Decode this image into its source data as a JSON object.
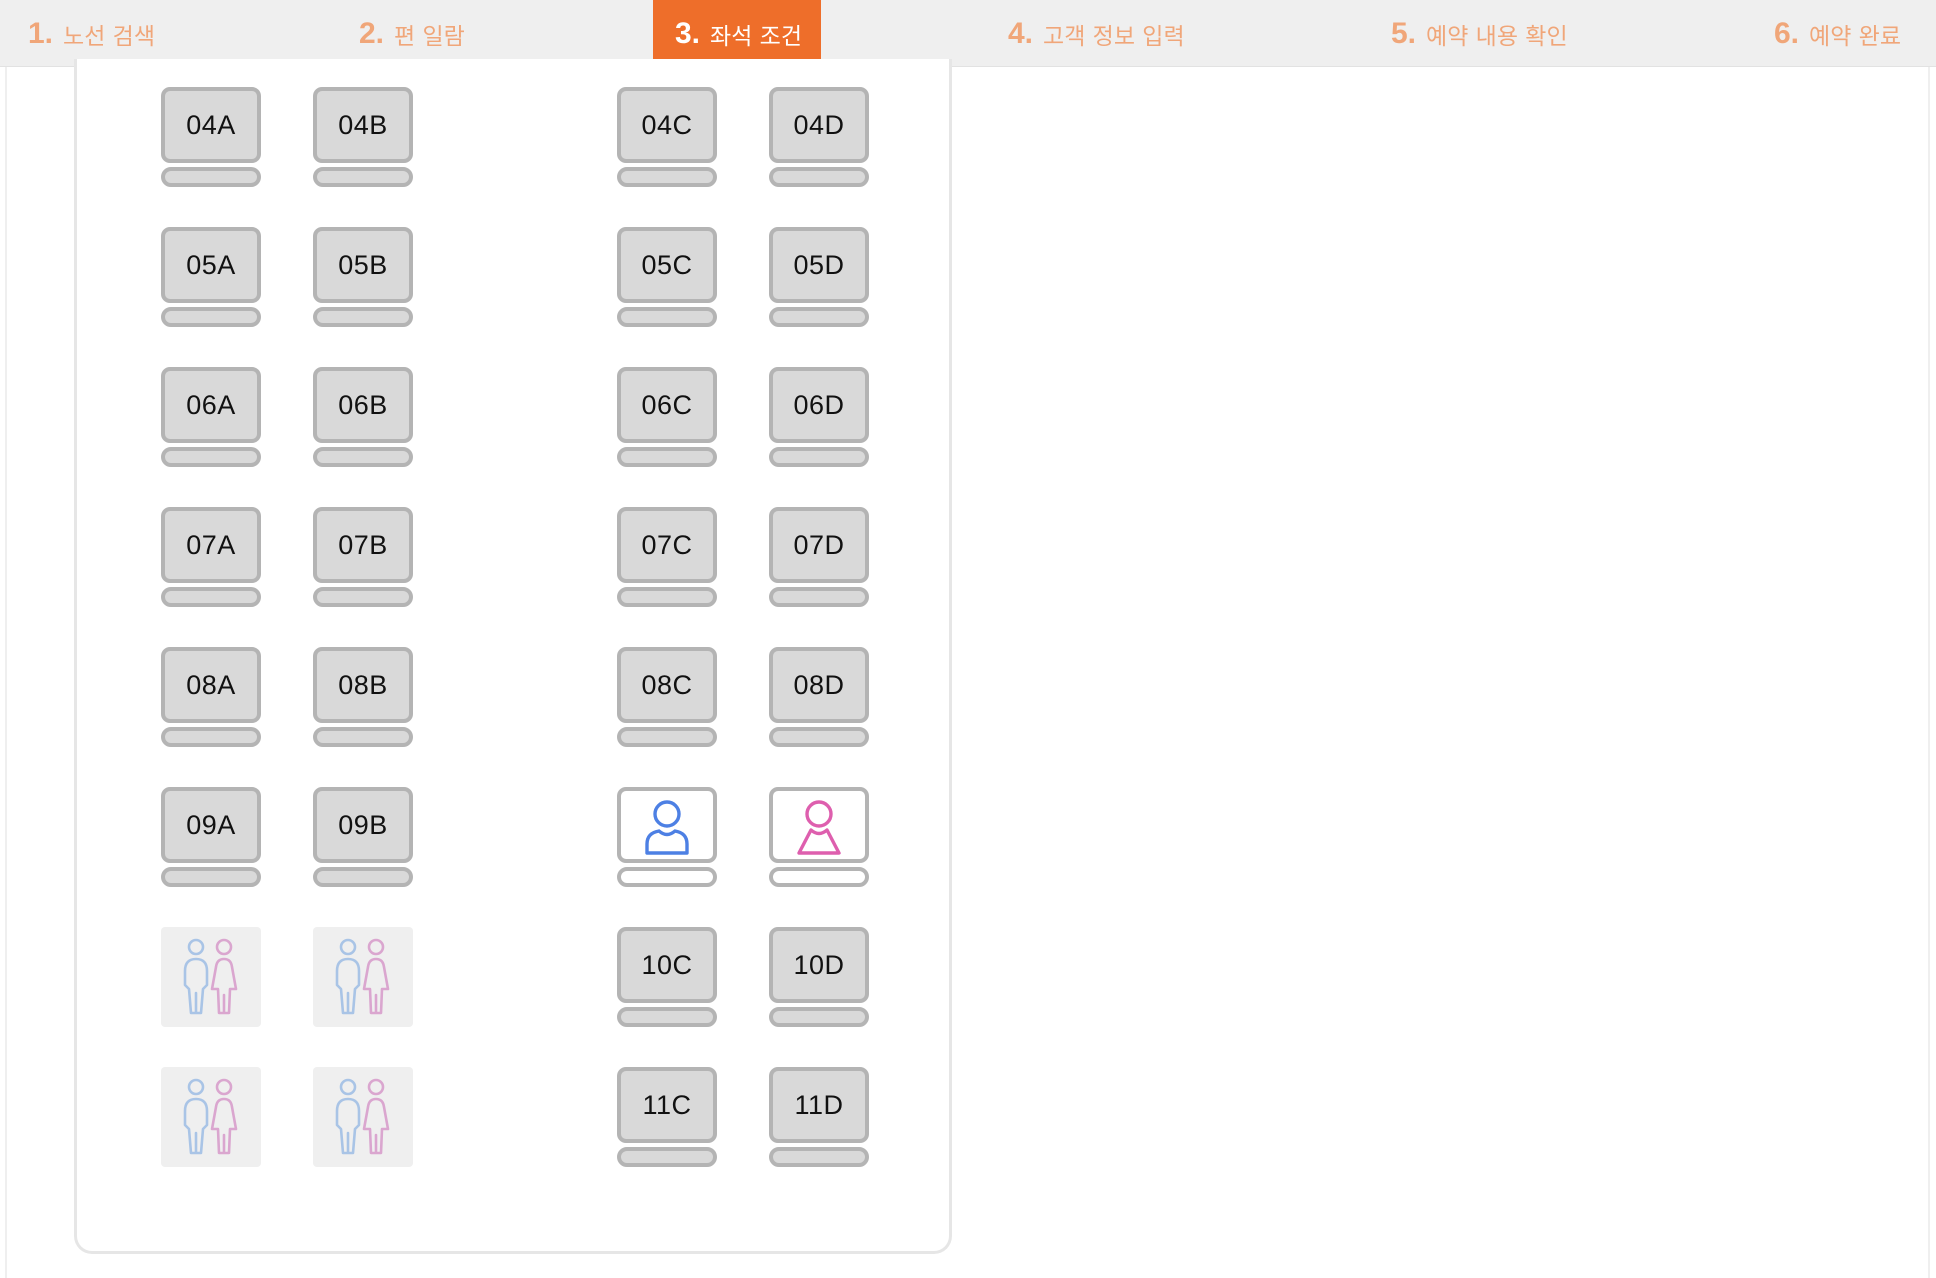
{
  "steps": [
    {
      "num": "1.",
      "label": "노선 검색",
      "active": false
    },
    {
      "num": "2.",
      "label": "편 일람",
      "active": false
    },
    {
      "num": "3.",
      "label": "좌석 조건",
      "active": true
    },
    {
      "num": "4.",
      "label": "고객 정보 입력",
      "active": false
    },
    {
      "num": "5.",
      "label": "예약 내용 확인",
      "active": false
    },
    {
      "num": "6.",
      "label": "예약 완료",
      "active": false
    }
  ],
  "colors": {
    "accent": "#ee6e2a",
    "step_inactive": "#f0a679",
    "male": "#4d80e4",
    "female": "#de5fae"
  },
  "seat_rows": [
    {
      "A": "04A",
      "B": "04B",
      "C": "04C",
      "D": "04D"
    },
    {
      "A": "05A",
      "B": "05B",
      "C": "05C",
      "D": "05D"
    },
    {
      "A": "06A",
      "B": "06B",
      "C": "06C",
      "D": "06D"
    },
    {
      "A": "07A",
      "B": "07B",
      "C": "07C",
      "D": "07D"
    },
    {
      "A": "08A",
      "B": "08B",
      "C": "08C",
      "D": "08D"
    },
    {
      "A": "09A",
      "B": "09B",
      "C": "taken-male",
      "D": "taken-female"
    },
    {
      "A": "restroom",
      "B": "restroom",
      "C": "10C",
      "D": "10D"
    },
    {
      "A": "restroom",
      "B": "restroom",
      "C": "11C",
      "D": "11D"
    }
  ],
  "icons": {
    "taken_male": "male-passenger-icon",
    "taken_female": "female-passenger-icon",
    "restroom": "restroom-icon"
  }
}
